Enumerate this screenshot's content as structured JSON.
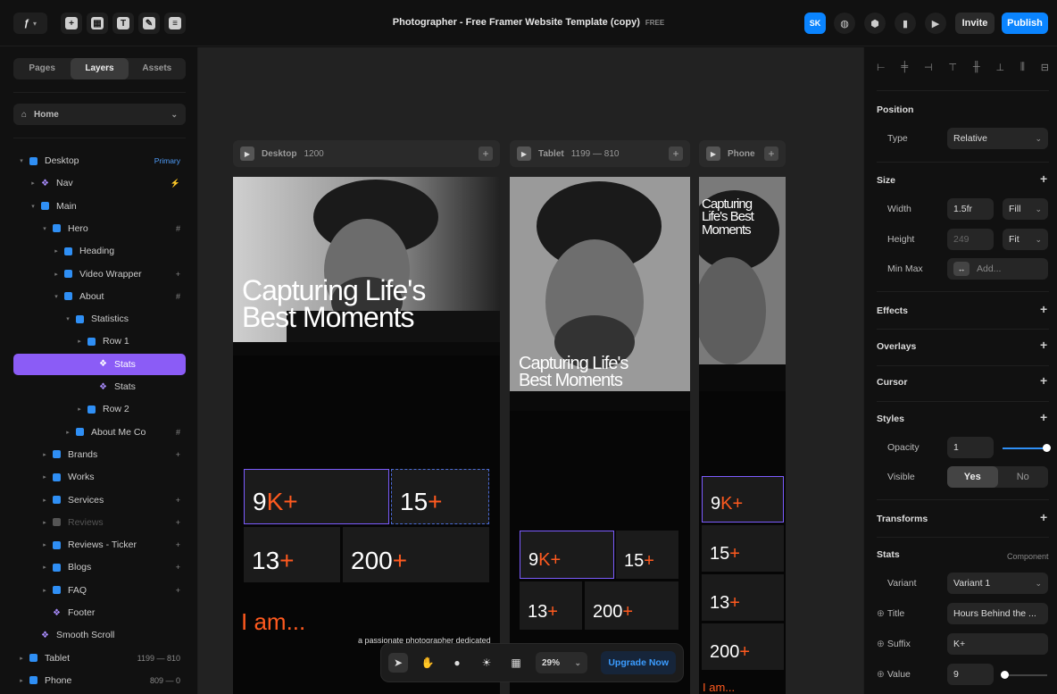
{
  "app": {
    "title": "Photographer - Free Framer Website Template (copy)",
    "title_badge": "FREE"
  },
  "toolbar": {
    "avatar_initials": "SK",
    "invite_label": "Invite",
    "publish_label": "Publish",
    "accent": "#0a84ff"
  },
  "left_panel": {
    "tabs": [
      {
        "label": "Pages",
        "active": false
      },
      {
        "label": "Layers",
        "active": true
      },
      {
        "label": "Assets",
        "active": false
      }
    ],
    "page_select": "Home",
    "layers": [
      {
        "label": "Desktop",
        "kind": "stack",
        "right": "Primary"
      },
      {
        "label": "Nav",
        "kind": "component",
        "right": "⚡"
      },
      {
        "label": "Main",
        "kind": "stack",
        "right": ""
      },
      {
        "label": "Hero",
        "kind": "stack",
        "right": "#"
      },
      {
        "label": "Heading",
        "kind": "stack",
        "right": ""
      },
      {
        "label": "Video Wrapper",
        "kind": "stack",
        "right": "+"
      },
      {
        "label": "About",
        "kind": "stack",
        "right": "#"
      },
      {
        "label": "Statistics",
        "kind": "stack",
        "right": ""
      },
      {
        "label": "Row 1",
        "kind": "stack",
        "right": ""
      },
      {
        "label": "Stats",
        "kind": "component",
        "right": "",
        "selected": true
      },
      {
        "label": "Stats",
        "kind": "component",
        "right": ""
      },
      {
        "label": "Row 2",
        "kind": "stack",
        "right": ""
      },
      {
        "label": "About Me Co",
        "kind": "stack",
        "right": "#"
      },
      {
        "label": "Brands",
        "kind": "stack",
        "right": "+"
      },
      {
        "label": "Works",
        "kind": "stack",
        "right": ""
      },
      {
        "label": "Services",
        "kind": "stack",
        "right": "+"
      },
      {
        "label": "Reviews",
        "kind": "stack",
        "right": "+",
        "dim": true
      },
      {
        "label": "Reviews - Ticker",
        "kind": "stack",
        "right": "+"
      },
      {
        "label": "Blogs",
        "kind": "stack",
        "right": "+"
      },
      {
        "label": "FAQ",
        "kind": "stack",
        "right": "+"
      },
      {
        "label": "Footer",
        "kind": "component",
        "right": ""
      },
      {
        "label": "Smooth Scroll",
        "kind": "component",
        "right": ""
      },
      {
        "label": "Tablet",
        "kind": "stack",
        "right": "1199 — 810"
      },
      {
        "label": "Phone",
        "kind": "stack",
        "right": "809 — 0"
      }
    ]
  },
  "canvas": {
    "breakpoints": [
      {
        "name": "Desktop",
        "range": "1200"
      },
      {
        "name": "Tablet",
        "range": "1199 — 810"
      },
      {
        "name": "Phone",
        "range": ""
      }
    ],
    "site": {
      "headline_line1": "Capturing Life's",
      "headline_line2": "Best Moments",
      "headline_phone_1": "Capturing",
      "headline_phone_2": "Life's Best",
      "headline_phone_3": "Moments",
      "stats": [
        {
          "num": "9",
          "suffix": "K+"
        },
        {
          "num": "15",
          "suffix": "+"
        },
        {
          "num": "13",
          "suffix": "+"
        },
        {
          "num": "200",
          "suffix": "+"
        }
      ],
      "iam": "I am...",
      "about_text": "a passionate photographer dedicated",
      "orange": "#ff5a1f"
    }
  },
  "bottom_bar": {
    "zoom": "29%",
    "upgrade_label": "Upgrade Now"
  },
  "right_panel": {
    "position": {
      "title": "Position",
      "type_label": "Type",
      "type_value": "Relative"
    },
    "size": {
      "title": "Size",
      "width_label": "Width",
      "width_value": "1.5fr",
      "width_mode": "Fill",
      "height_label": "Height",
      "height_value": "249",
      "height_mode": "Fit",
      "minmax_label": "Min Max",
      "minmax_value": "Add..."
    },
    "effects": "Effects",
    "overlays": "Overlays",
    "cursor": "Cursor",
    "styles": {
      "title": "Styles",
      "opacity_label": "Opacity",
      "opacity_value": "1",
      "opacity_level": 1.0,
      "visible_label": "Visible",
      "yes": "Yes",
      "no": "No"
    },
    "transforms": "Transforms",
    "stats": {
      "title": "Stats",
      "tag": "Component",
      "variant_label": "Variant",
      "variant_value": "Variant 1",
      "title_label": "Title",
      "title_value": "Hours Behind the ...",
      "suffix_label": "Suffix",
      "suffix_value": "K+",
      "value_label": "Value",
      "value_value": "9",
      "value_level": 0.0
    }
  }
}
